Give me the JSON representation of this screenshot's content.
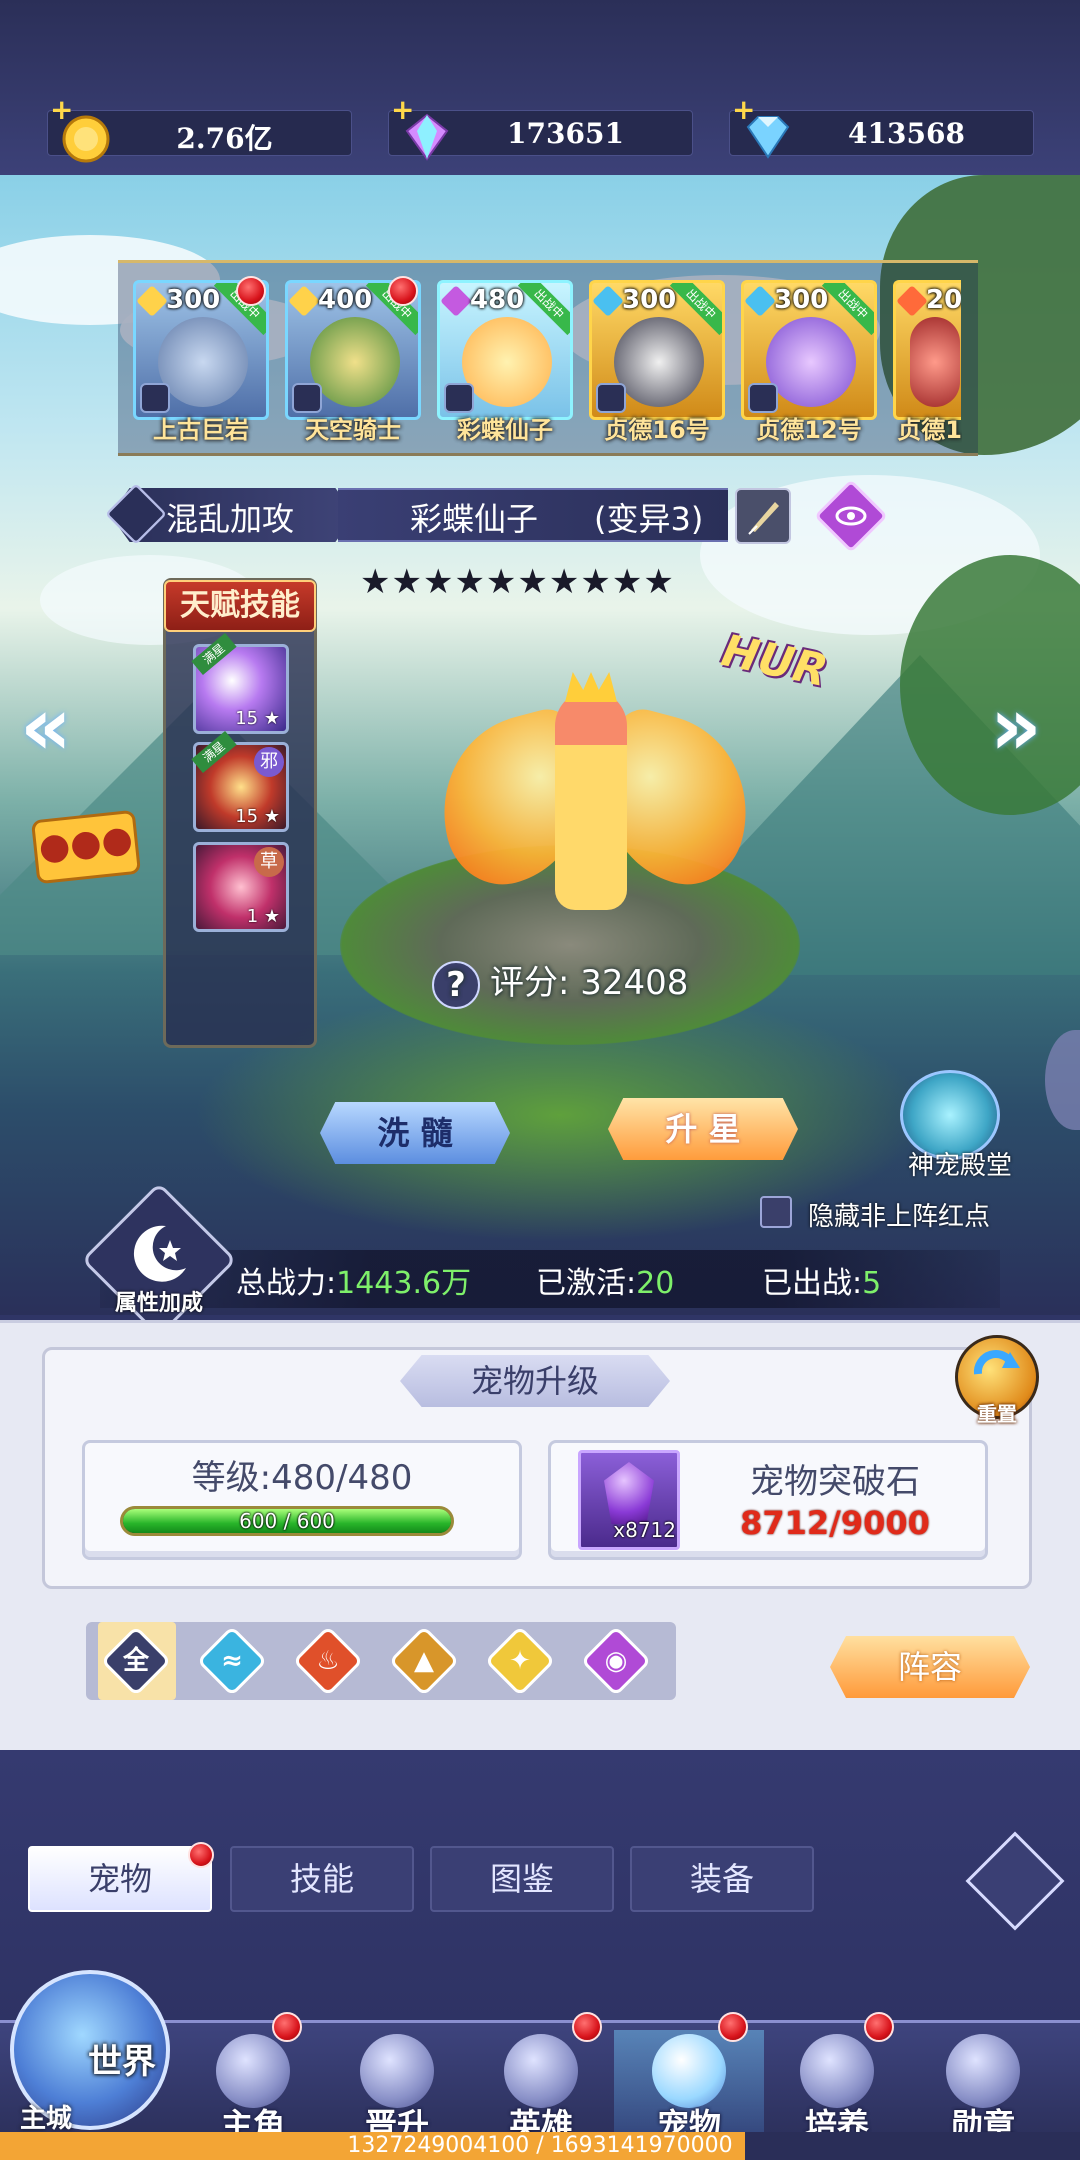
{
  "currencies": [
    {
      "name": "gold",
      "value": "2.76亿",
      "color": "#ffcf3a"
    },
    {
      "name": "rainbow-gem",
      "value": "173651",
      "color": "#d58bff"
    },
    {
      "name": "diamond",
      "value": "413568",
      "color": "#7ad3ff"
    }
  ],
  "roster": [
    {
      "level": "300",
      "name": "上古巨岩",
      "flag": "出战中",
      "element": "light"
    },
    {
      "level": "400",
      "name": "天空骑士",
      "flag": "出战中",
      "element": "light"
    },
    {
      "level": "480",
      "name": "彩蝶仙子",
      "flag": "出战中",
      "element": "dark"
    },
    {
      "level": "300",
      "name": "贞德16号",
      "flag": "出战中",
      "element": "water"
    },
    {
      "level": "300",
      "name": "贞德12号",
      "flag": "出战中",
      "element": "water"
    },
    {
      "level": "20",
      "name": "贞德1",
      "flag": "",
      "element": "fire"
    }
  ],
  "selected": {
    "skill_tag": "混乱加攻",
    "name": "彩蝶仙子",
    "variant": "(变异3)",
    "stars": "★★★★★★★★★★",
    "score_label": "评分:",
    "score": "32408",
    "badge": "HUR"
  },
  "talent": {
    "title": "天赋技能",
    "skills": [
      {
        "level": "15",
        "corner": "满星"
      },
      {
        "level": "15",
        "corner": "满星",
        "tag": "邪"
      },
      {
        "level": "1",
        "corner": "",
        "tag": "草"
      }
    ]
  },
  "actions": {
    "wash": "洗 髓",
    "star_up": "升 星",
    "temple": "神宠殿堂",
    "hide_red_dot": "隐藏非上阵红点"
  },
  "stats": {
    "attr_label": "属性加成",
    "power_label": "总战力:",
    "power": "1443.6万",
    "active_label": "已激活:",
    "active": "20",
    "deployed_label": "已出战:",
    "deployed": "5"
  },
  "upgrade": {
    "title": "宠物升级",
    "reset": "重置",
    "level_label": "等级:",
    "level": "480/480",
    "exp_text": "600 / 600",
    "exp_fraction": 1.0,
    "stone_name": "宠物突破石",
    "stone_count": "x8712",
    "stone_progress": "8712/9000"
  },
  "filters": {
    "all": "全",
    "elements": [
      "water",
      "fire",
      "earth",
      "light",
      "dark"
    ],
    "lineup": "阵容"
  },
  "sub_tabs": [
    "宠物",
    "技能",
    "图鉴",
    "装备"
  ],
  "nav": {
    "world": "世界",
    "city": "主城",
    "items": [
      "主角",
      "晋升",
      "英雄",
      "宠物",
      "培养",
      "勋章"
    ]
  },
  "footer": "1327249004100 / 1693141970000"
}
